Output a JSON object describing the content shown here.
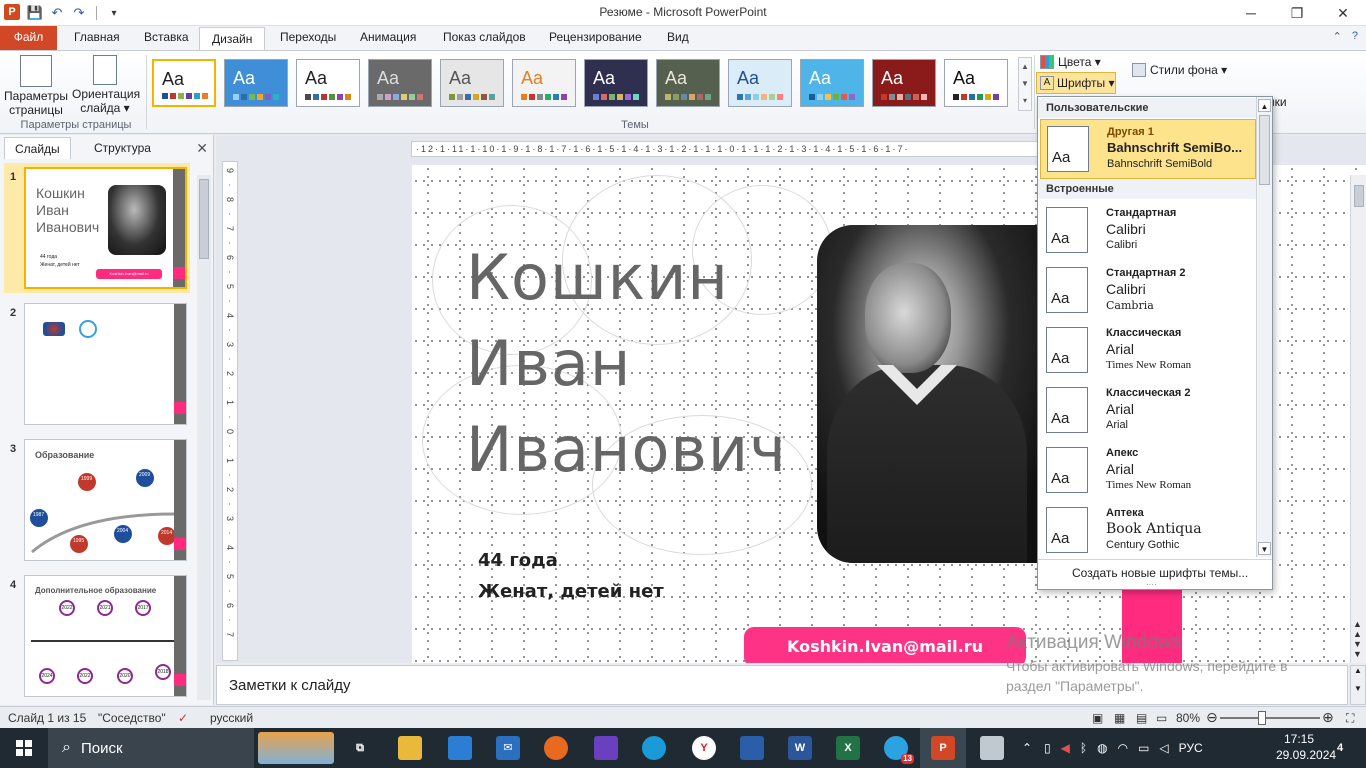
{
  "window": {
    "title": "Резюме - Microsoft PowerPoint",
    "minimize": "─",
    "maximize": "❐",
    "close": "✕"
  },
  "qat": {
    "save": "💾",
    "undo": "↶",
    "redo": "↷",
    "customize": "▾"
  },
  "tabs": [
    {
      "label": "Файл"
    },
    {
      "label": "Главная"
    },
    {
      "label": "Вставка"
    },
    {
      "label": "Дизайн"
    },
    {
      "label": "Переходы"
    },
    {
      "label": "Анимация"
    },
    {
      "label": "Показ слайдов"
    },
    {
      "label": "Рецензирование"
    },
    {
      "label": "Вид"
    }
  ],
  "ribbon": {
    "page_setup": {
      "label_line1": "Параметры",
      "label_line2": "страницы"
    },
    "orientation": {
      "label_line1": "Ориентация",
      "label_line2": "слайда ▾"
    },
    "page_group_label": "Параметры страницы",
    "themes_group_label": "Темы",
    "colors_label": "Цвета ▾",
    "fonts_label": "Шрифты ▾",
    "bg_styles_label": "Стили фона ▾",
    "partial_label": "нки",
    "theme_sample": "Aa"
  },
  "themes": [
    {
      "bg": "#ffffff",
      "fg": "#222222",
      "dots": [
        "#1f4e9c",
        "#c0392b",
        "#8bb14a",
        "#6a3d9a",
        "#2aa1c7",
        "#e67e22"
      ]
    },
    {
      "bg": "#3f8fd8",
      "fg": "#ffffff",
      "dots": [
        "#9ad0f5",
        "#2b6cb0",
        "#76b852",
        "#f5a623",
        "#7b61c4",
        "#2ab4c0"
      ]
    },
    {
      "bg": "#ffffff",
      "fg": "#222222",
      "dots": [
        "#4a4a4a",
        "#2f6db5",
        "#b33",
        "#5a8f3c",
        "#8e44ad",
        "#d68910"
      ]
    },
    {
      "bg": "#6a6a6a",
      "fg": "#dddddd",
      "dots": [
        "#aaaaaa",
        "#c8a2c8",
        "#88aadd",
        "#ddcc77",
        "#99cc99",
        "#cc7777"
      ]
    },
    {
      "bg": "#e6e6e6",
      "fg": "#555555",
      "dots": [
        "#7a9a3a",
        "#a0a0a0",
        "#3a6ea5",
        "#d9a520",
        "#8a5a44",
        "#5aa0a0"
      ]
    },
    {
      "bg": "#f3f3f3",
      "fg": "#e67e22",
      "dots": [
        "#e67e22",
        "#c0392b",
        "#7f8c8d",
        "#27ae60",
        "#2980b9",
        "#8e44ad"
      ]
    },
    {
      "bg": "#2f2f4f",
      "fg": "#ffffff",
      "dots": [
        "#6c7fd6",
        "#d46a6a",
        "#7ab56a",
        "#d6b46a",
        "#9a6ad6",
        "#6ad6c8"
      ]
    },
    {
      "bg": "#56604e",
      "fg": "#e8e8d8",
      "dots": [
        "#b8b86a",
        "#8a9a6a",
        "#6a8a9a",
        "#d6a66a",
        "#a66a6a",
        "#6aa68a"
      ]
    },
    {
      "bg": "#d9ecf7",
      "fg": "#1f4e9c",
      "dots": [
        "#2e75b6",
        "#5ba3d0",
        "#92cddc",
        "#f4b183",
        "#a9d18e",
        "#ff7f7f"
      ]
    },
    {
      "bg": "#4fb4e8",
      "fg": "#ffffff",
      "dots": [
        "#1a5c99",
        "#8ed0f0",
        "#f7c242",
        "#67b346",
        "#e05a4f",
        "#8a6ac4"
      ]
    },
    {
      "bg": "#8b1a1a",
      "fg": "#ffffff",
      "dots": [
        "#c0392b",
        "#7f8c8d",
        "#e6b0aa",
        "#5d6d7e",
        "#cd6155",
        "#f5b7b1"
      ]
    },
    {
      "bg": "#ffffff",
      "fg": "#111111",
      "dots": [
        "#222222",
        "#c0392b",
        "#2471a3",
        "#229954",
        "#d4ac0d",
        "#7d3c98"
      ]
    }
  ],
  "left_panel": {
    "tab_slides": "Слайды",
    "tab_outline": "Структура",
    "close": "✕"
  },
  "thumbnails": [
    {
      "num": "1",
      "name_lines": [
        "Кошкин",
        "Иван",
        "Иванович"
      ],
      "age": "44 года",
      "family": "Женат, детей нет",
      "email": "Koshkin.Ivan@mail.ru"
    },
    {
      "num": "2"
    },
    {
      "num": "3",
      "title": "Образование",
      "years": [
        "1999",
        "2009",
        "1987",
        "2004",
        "2014",
        "1995"
      ]
    },
    {
      "num": "4",
      "title": "Дополнительное образование",
      "years": [
        "2022",
        "2021",
        "2017",
        "2024",
        "2022",
        "2020",
        "2018"
      ]
    }
  ],
  "slide": {
    "name_line1": "Кошкин",
    "name_line2": "Иван",
    "name_line3": "Иванович",
    "age": "44 года",
    "family": "Женат, детей нет",
    "email": "Koshkin.Ivan@mail.ru"
  },
  "ruler_text": "·12·1·11·1·10·1·9·1·8·1·7·1·6·1·5·1·4·1·3·1·2·1·1·1·0·1·1·1·2·1·3·1·4·1·5·1·6·1·7·",
  "vruler_text": "9 · 8 · 7 · 6 · 5 · 4 · 3 · 2 · 1 · 0 · 1 · 2 · 3 · 4 · 5 · 6 · 7",
  "notes_placeholder": "Заметки к слайду",
  "fonts_dropdown": {
    "section_custom": "Пользовательские",
    "section_builtin": "Встроенные",
    "items": [
      {
        "name": "Другая 1",
        "heading_font": "Bahnschrift SemiBo...",
        "body_font": "Bahnschrift SemiBold",
        "selected": true
      },
      {
        "name": "Стандартная",
        "heading_font": "Calibri",
        "body_font": "Calibri"
      },
      {
        "name": "Стандартная 2",
        "heading_font": "Calibri",
        "body_font": "Cambria"
      },
      {
        "name": "Классическая",
        "heading_font": "Arial",
        "body_font": "Times New Roman"
      },
      {
        "name": "Классическая 2",
        "heading_font": "Arial",
        "body_font": "Arial"
      },
      {
        "name": "Апекс",
        "heading_font": "Arial",
        "body_font": "Times New Roman"
      },
      {
        "name": "Аптека",
        "heading_font": "Book Antiqua",
        "body_font": "Century Gothic"
      }
    ],
    "sample": "Aa",
    "create_new": "Создать новые шрифты темы...",
    "grip": "····"
  },
  "status": {
    "slide_info": "Слайд 1 из 15",
    "theme_name": "\"Соседство\"",
    "language": "русский",
    "zoom": "80%"
  },
  "watermark": {
    "title": "Активация Windows",
    "subtitle": "Чтобы активировать Windows, перейдите в раздел \"Параметры\"."
  },
  "taskbar": {
    "search_label": "Поиск",
    "language": "РУС",
    "time": "17:15",
    "date": "29.09.2024",
    "notifications": "4",
    "telegram_badge": "13"
  },
  "colors": {
    "accent_pink": "#ff2b7f",
    "file_tab": "#d24726",
    "taskbar": "#1f2a33"
  }
}
